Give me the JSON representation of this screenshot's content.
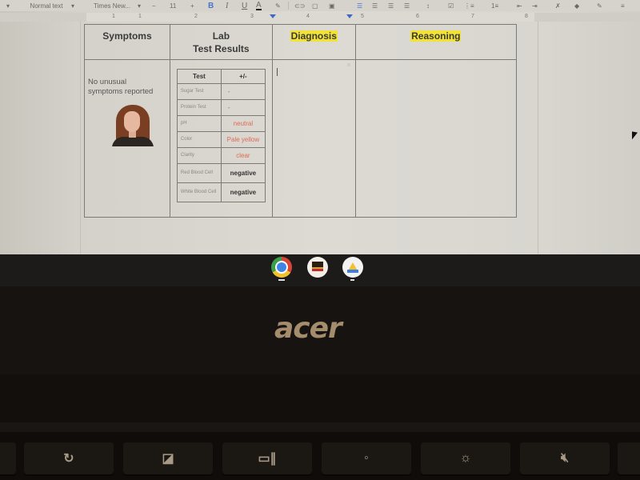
{
  "toolbar": {
    "style": "Normal text",
    "font": "Times New...",
    "font_size": "11",
    "minus": "−",
    "plus": "+",
    "bold": "B",
    "italic": "I",
    "underline": "U",
    "text_color": "A"
  },
  "ruler": {
    "marks": [
      "1",
      "1",
      "2",
      "3",
      "4",
      "5",
      "6",
      "7",
      "8"
    ]
  },
  "table": {
    "headers": {
      "symptoms": "Symptoms",
      "lab_line1": "Lab",
      "lab_line2": "Test Results",
      "diagnosis": "Diagnosis",
      "reasoning": "Reasoning"
    },
    "symptoms_text_line1": "No unusual",
    "symptoms_text_line2": "symptoms reported",
    "lab": {
      "col_test": "Test",
      "col_result": "+/-",
      "rows": [
        {
          "test": "Sugar Test",
          "result": "-"
        },
        {
          "test": "Protein Test",
          "result": "-"
        },
        {
          "test": "pH",
          "result": "neutral"
        },
        {
          "test": "Color",
          "result": "Pale yellow"
        },
        {
          "test": "Clarity",
          "result": "clear"
        },
        {
          "test": "Red Blood Cell",
          "result": "negative"
        },
        {
          "test": "White Blood Cell",
          "result": "negative"
        }
      ]
    },
    "diagnosis_value": "",
    "reasoning_value": ""
  },
  "shelf": {
    "apps": [
      "Chrome",
      "Movie app",
      "Google Drive"
    ]
  },
  "laptop": {
    "brand": "acer"
  },
  "keys": [
    "refresh",
    "fullscreen",
    "overview",
    "brightness-down",
    "brightness-up",
    "mute"
  ],
  "colors": {
    "highlight": "#f2e236",
    "result_red": "#e06a55",
    "accent_blue": "#4a74c9"
  }
}
